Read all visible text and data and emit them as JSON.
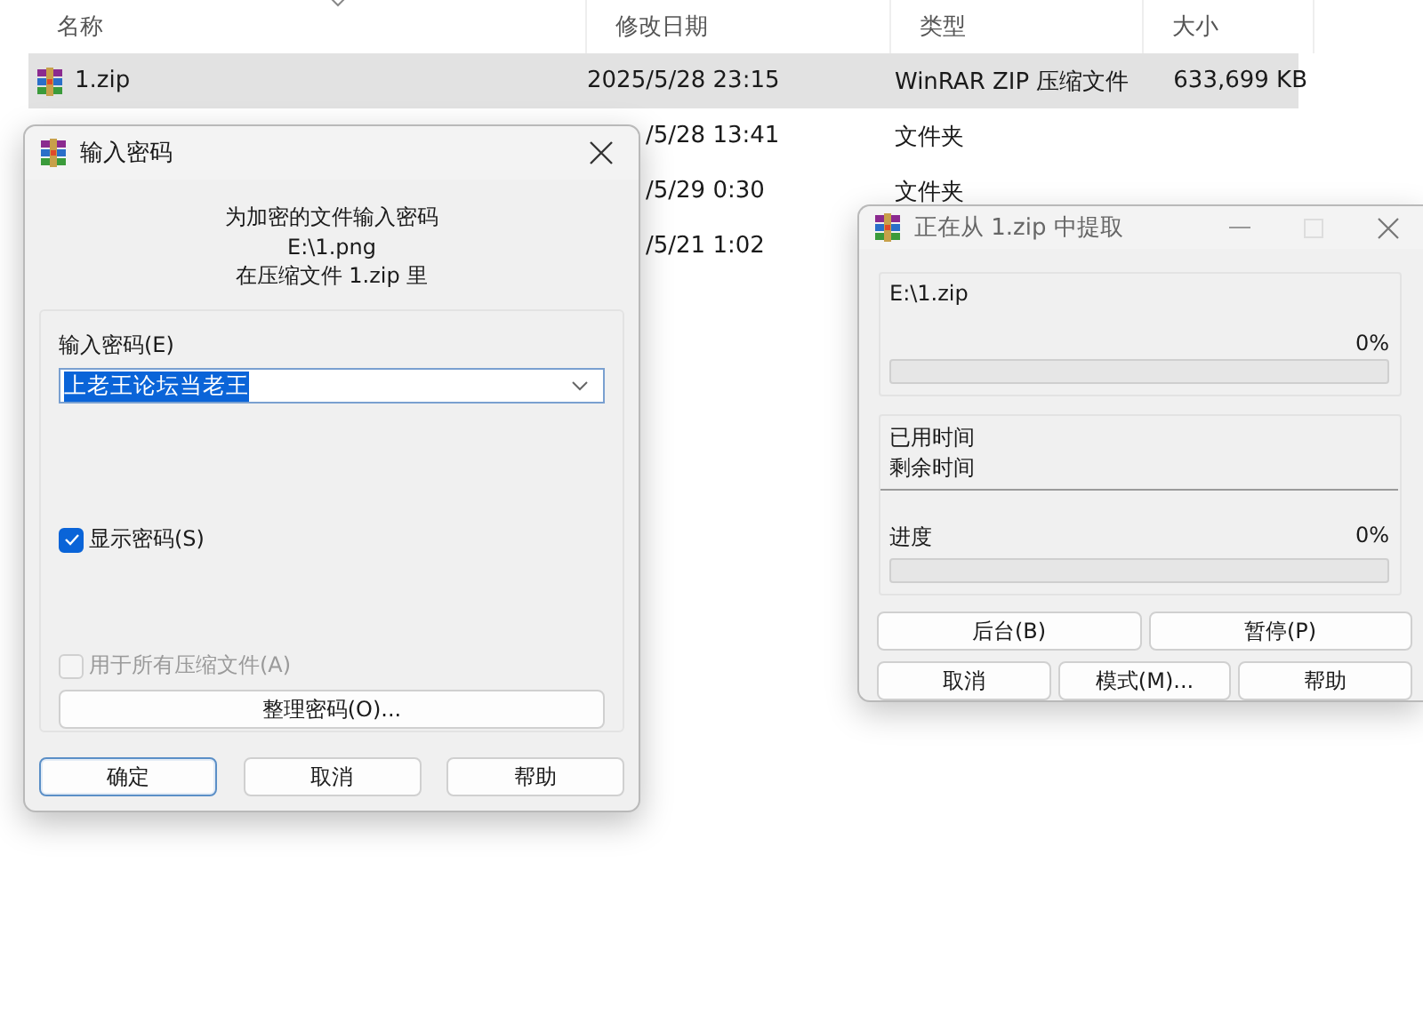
{
  "explorer": {
    "columns": [
      "名称",
      "修改日期",
      "类型",
      "大小"
    ],
    "rows": [
      {
        "name": "1.zip",
        "date": "2025/5/28 23:15",
        "type": "WinRAR ZIP 压缩文件",
        "size": "633,699 KB",
        "selected": true
      },
      {
        "date": "/5/28 13:41",
        "type": "文件夹",
        "selected": false
      },
      {
        "date": "/5/29 0:30",
        "type": "文件夹",
        "selected": false
      },
      {
        "date": "/5/21 1:02",
        "selected": false
      }
    ]
  },
  "password_dialog": {
    "title": "输入密码",
    "prompt": [
      "为加密的文件输入密码",
      "E:\\1.png",
      "在压缩文件 1.zip 里"
    ],
    "field_label": "输入密码(E)",
    "password": "上老王论坛当老王",
    "checkboxes": [
      {
        "label": "显示密码(S)",
        "checked": true,
        "disabled": false
      },
      {
        "label": "用于所有压缩文件(A)",
        "checked": false,
        "disabled": true
      }
    ],
    "organize_button": "整理密码(O)...",
    "buttons": [
      {
        "label": "确定",
        "default": true
      },
      {
        "label": "取消",
        "default": false
      },
      {
        "label": "帮助",
        "default": false
      }
    ]
  },
  "extract_window": {
    "title": "正在从 1.zip 中提取",
    "archive": "E:\\1.zip",
    "archive_percent": "0%",
    "archive_progress": {
      "level": 0
    },
    "elapsed_label": "已用时间",
    "remaining_label": "剩余时间",
    "progress_label": "进度",
    "progress_percent": "0%",
    "progress": {
      "level": 0
    },
    "buttons": [
      [
        "后台(B)",
        "暂停(P)"
      ],
      [
        "取消",
        "模式(M)...",
        "帮助"
      ]
    ]
  }
}
